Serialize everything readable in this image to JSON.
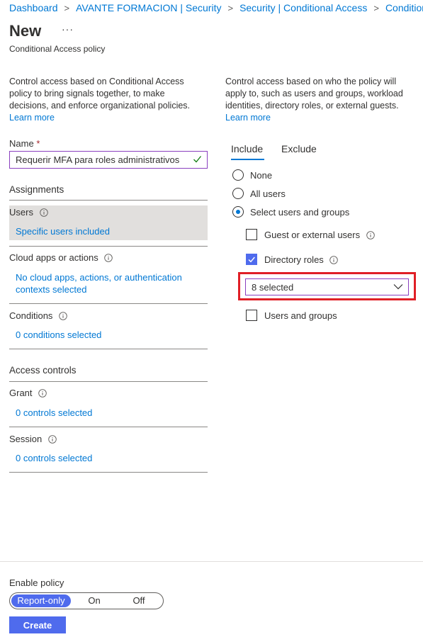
{
  "breadcrumb": [
    "Dashboard",
    "AVANTE FORMACION | Security",
    "Security | Conditional Access",
    "Conditional A"
  ],
  "header": {
    "title": "New",
    "more": "···",
    "subtitle": "Conditional Access policy"
  },
  "left_description": {
    "text": "Control access based on Conditional Access policy to bring signals together, to make decisions, and enforce organizational policies.",
    "link": "Learn more"
  },
  "right_description": {
    "text": "Control access based on who the policy will apply to, such as users and groups, workload identities, directory roles, or external guests.",
    "link": "Learn more"
  },
  "name_field": {
    "label": "Name",
    "required_mark": "*",
    "value": "Requerir MFA para roles administrativos"
  },
  "assignments": {
    "title": "Assignments",
    "users": {
      "label": "Users",
      "value": "Specific users included"
    },
    "cloud_apps": {
      "label": "Cloud apps or actions",
      "value": "No cloud apps, actions, or authentication contexts selected"
    },
    "conditions": {
      "label": "Conditions",
      "value": "0 conditions selected"
    }
  },
  "access_controls": {
    "title": "Access controls",
    "grant": {
      "label": "Grant",
      "value": "0 controls selected"
    },
    "session": {
      "label": "Session",
      "value": "0 controls selected"
    }
  },
  "tabs": {
    "include": "Include",
    "exclude": "Exclude",
    "active": "Include"
  },
  "include_options": {
    "none": "None",
    "all_users": "All users",
    "select": "Select users and groups",
    "selected": "Select users and groups"
  },
  "checkboxes": {
    "guest": {
      "label": "Guest or external users",
      "checked": false
    },
    "directory_roles": {
      "label": "Directory roles",
      "checked": true
    },
    "users_groups": {
      "label": "Users and groups",
      "checked": false
    }
  },
  "directory_roles_dropdown": {
    "value": "8 selected"
  },
  "enable_policy": {
    "label": "Enable policy",
    "options": [
      "Report-only",
      "On",
      "Off"
    ],
    "selected": "Report-only"
  },
  "create_button": "Create",
  "colors": {
    "link": "#0078d4",
    "accent": "#4f6bed",
    "highlight": "#e01f26",
    "input_border": "#8a3fbf"
  }
}
